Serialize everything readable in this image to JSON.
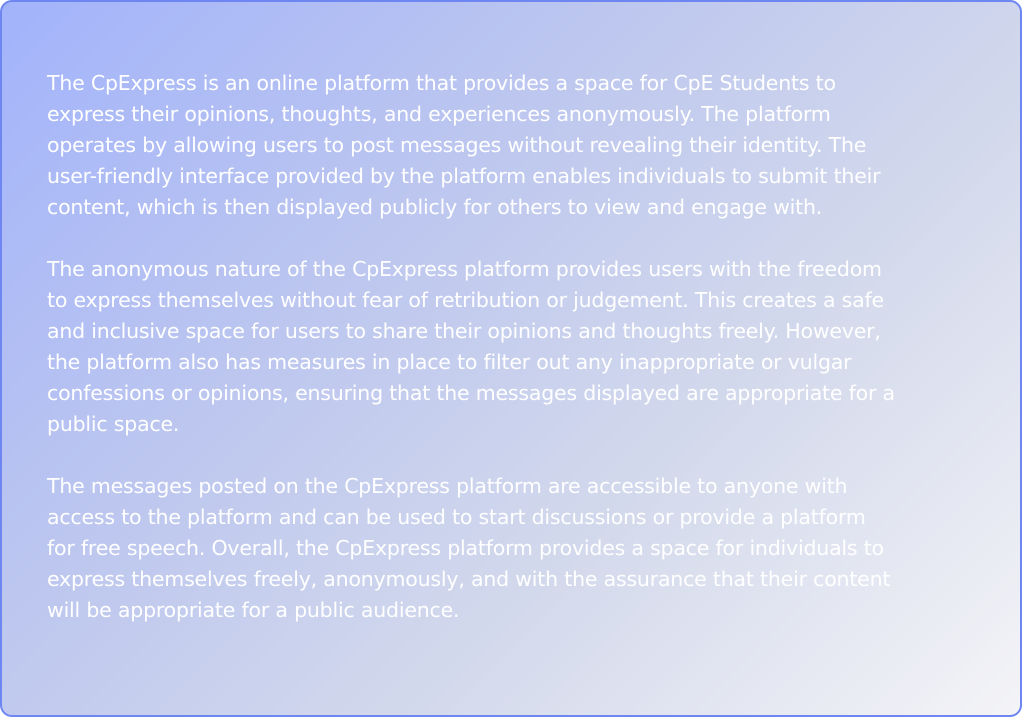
{
  "about": {
    "paragraphs": [
      "The CpExpress is an online platform that provides a space for CpE Students to\nexpress their opinions, thoughts, and experiences anonymously. The platform\noperates by allowing users to post messages without revealing their identity. The\nuser-friendly interface provided by the platform enables individuals to submit their\ncontent, which is then displayed publicly for others to view and engage with.",
      "The anonymous nature of the CpExpress platform provides users with the freedom\nto express themselves without fear of retribution or judgement. This creates a safe\nand inclusive space for users to share their opinions and thoughts freely. However,\nthe platform also has measures in place to filter out any inappropriate or vulgar\nconfessions or opinions, ensuring that the messages displayed are appropriate for a\npublic space.",
      "The messages posted on the CpExpress platform are accessible to anyone with\naccess to the platform and can be used to start discussions or provide a platform\nfor free speech. Overall, the CpExpress platform provides a space for individuals to\nexpress themselves freely, anonymously, and with the assurance that their content\nwill be appropriate for a public audience."
    ]
  },
  "colors": {
    "border": "#6d86f2",
    "gradient_start": "#a2b3fb",
    "gradient_end": "#f4f4f7",
    "text": "#ffffff"
  }
}
